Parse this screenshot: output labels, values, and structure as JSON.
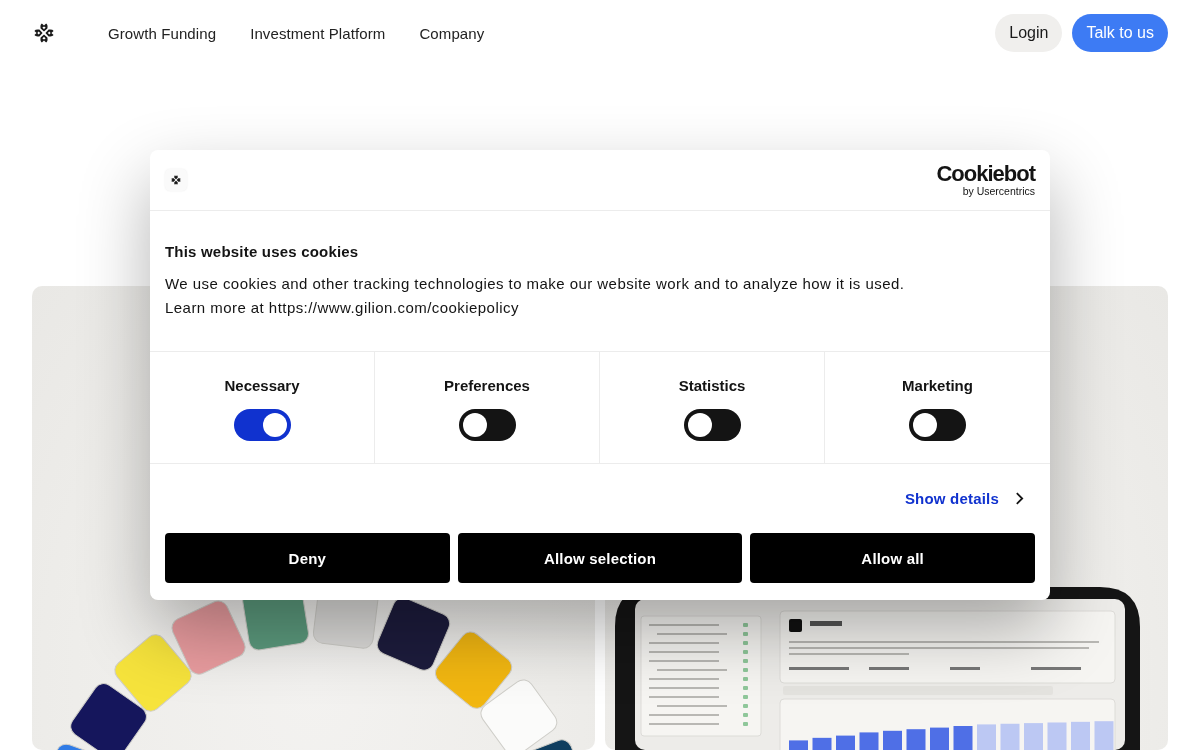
{
  "nav": {
    "links": [
      {
        "label": "Growth Funding"
      },
      {
        "label": "Investment Platform"
      },
      {
        "label": "Company"
      }
    ],
    "actions": [
      {
        "label": "Login",
        "kind": "secondary"
      },
      {
        "label": "Talk to us",
        "kind": "primary"
      }
    ]
  },
  "cookie_banner": {
    "brand": {
      "name": "Cookiebot",
      "byline": "by Usercentrics"
    },
    "title": "This website uses cookies",
    "body": [
      "We use cookies and other tracking technologies to make our website work and to analyze how it is used.",
      "Learn more at https://www.gilion.com/cookiepolicy"
    ],
    "categories": [
      {
        "label": "Necessary",
        "on": true
      },
      {
        "label": "Preferences",
        "on": false
      },
      {
        "label": "Statistics",
        "on": false
      },
      {
        "label": "Marketing",
        "on": false
      }
    ],
    "details_link": "Show details",
    "buttons": [
      "Deny",
      "Allow selection",
      "Allow all"
    ]
  }
}
